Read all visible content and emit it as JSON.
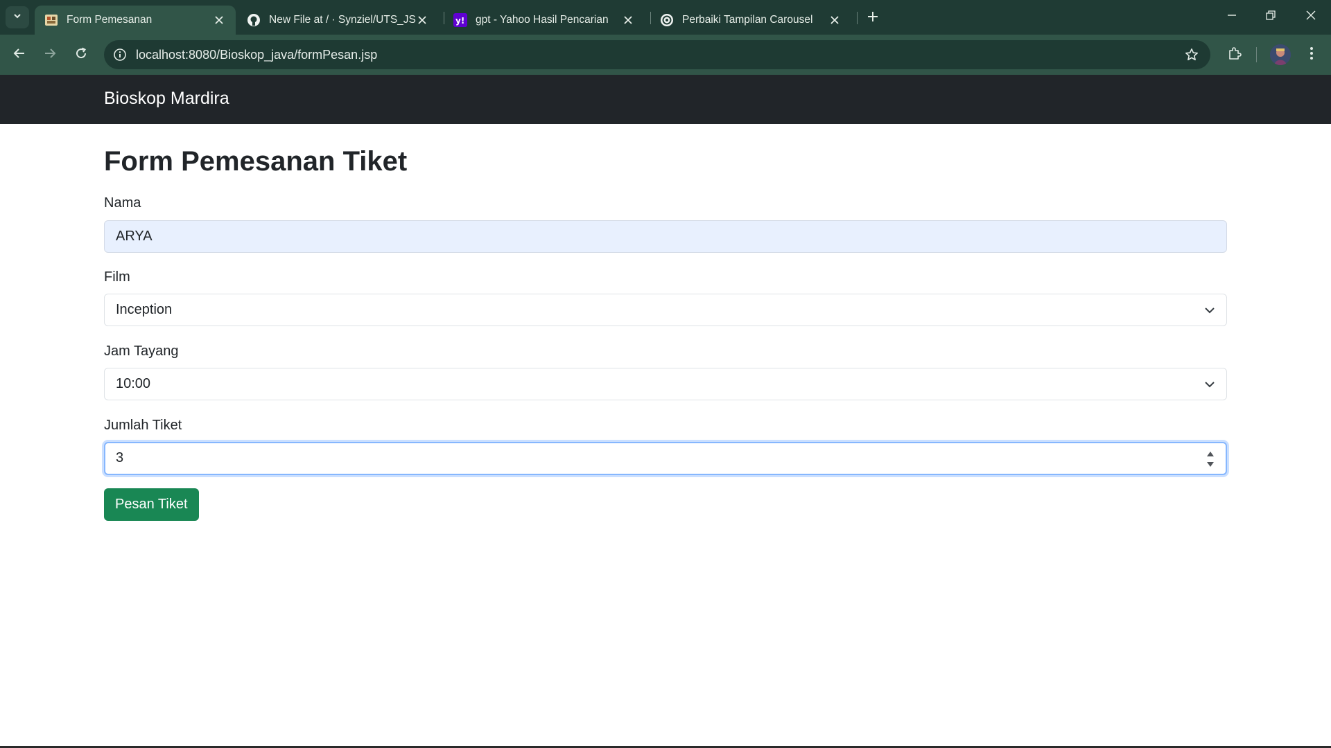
{
  "browser": {
    "tabs": [
      {
        "title": "Form Pemesanan",
        "icon": "cinema-favicon-icon",
        "active": true
      },
      {
        "title": "New File at / · Synziel/UTS_JSP_",
        "icon": "github-icon",
        "active": false
      },
      {
        "title": "gpt - Yahoo Hasil Pencarian",
        "icon": "yahoo-icon",
        "active": false
      },
      {
        "title": "Perbaiki Tampilan Carousel",
        "icon": "chatgpt-icon",
        "active": false
      }
    ],
    "address": {
      "url": "localhost:8080/Bioskop_java/formPesan.jsp"
    },
    "colors": {
      "tabstrip": "#1f3b34",
      "toolbar": "#315548"
    }
  },
  "navbar": {
    "brand": "Bioskop Mardira",
    "background": "#212529"
  },
  "form": {
    "title": "Form Pemesanan Tiket",
    "nama": {
      "label": "Nama",
      "value": "ARYA"
    },
    "film": {
      "label": "Film",
      "selected": "Inception"
    },
    "jam": {
      "label": "Jam Tayang",
      "selected": "10:00"
    },
    "jumlah": {
      "label": "Jumlah Tiket",
      "value": "3"
    },
    "submit": {
      "label": "Pesan Tiket",
      "color": "#198754"
    }
  }
}
